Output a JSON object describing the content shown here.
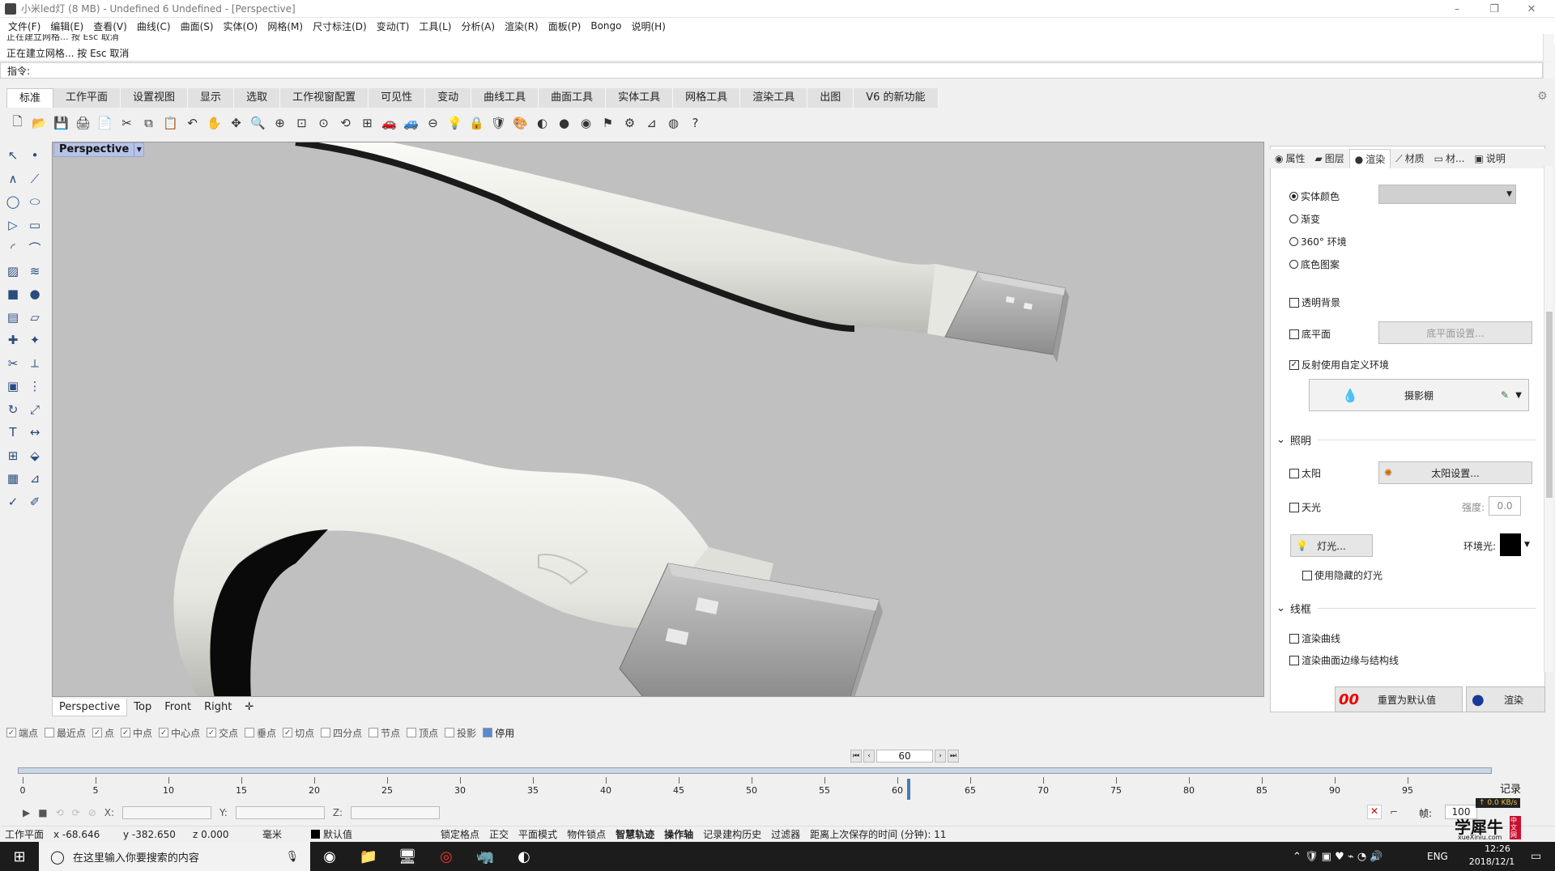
{
  "title": "小米led灯 (8 MB) - Undefined 6 Undefined - [Perspective]",
  "window_controls": {
    "minimize": "–",
    "maximize": "❐",
    "close": "✕"
  },
  "menu": [
    "文件(F)",
    "编辑(E)",
    "查看(V)",
    "曲线(C)",
    "曲面(S)",
    "实体(O)",
    "网格(M)",
    "尺寸标注(D)",
    "变动(T)",
    "工具(L)",
    "分析(A)",
    "渲染(R)",
    "面板(P)",
    "Bongo",
    "说明(H)"
  ],
  "command_history": [
    "正在建立网格... 按 Esc 取消",
    "正在建立网格... 按 Esc 取消"
  ],
  "command_prompt": "指令:",
  "tabs": [
    "标准",
    "工作平面",
    "设置视图",
    "显示",
    "选取",
    "工作视窗配置",
    "可见性",
    "变动",
    "曲线工具",
    "曲面工具",
    "实体工具",
    "网格工具",
    "渲染工具",
    "出图",
    "V6 的新功能"
  ],
  "active_tab": "标准",
  "toolbar_icons": [
    "new-icon",
    "open-icon",
    "save-icon",
    "print-icon",
    "import-icon",
    "cut-icon",
    "copy-icon",
    "paste-icon",
    "undo-icon",
    "pan-icon",
    "move-view-icon",
    "zoom-icon",
    "zoom-window-icon",
    "zoom-extents-icon",
    "zoom-selected-icon",
    "rotate-view-icon",
    "four-view-icon",
    "car-icon",
    "car2-icon",
    "grid-icon",
    "light-icon",
    "lock-icon",
    "layer-icon",
    "color-icon",
    "shade-icon",
    "render-sphere-icon",
    "render-icon",
    "select-filter-icon",
    "settings-gear-icon",
    "options-icon",
    "globe-icon",
    "help-icon"
  ],
  "toolbar_glyphs": [
    "🗋",
    "📂",
    "💾",
    "🖨",
    "📄",
    "✂",
    "⧉",
    "📋",
    "↶",
    "✋",
    "✥",
    "🔍",
    "⊕",
    "⊡",
    "⊙",
    "⟲",
    "⊞",
    "🚗",
    "🚙",
    "⊖",
    "💡",
    "🔒",
    "🛡",
    "🎨",
    "◐",
    "●",
    "◉",
    "⚑",
    "⚙",
    "⊿",
    "◍",
    "?"
  ],
  "viewport": {
    "name": "Perspective",
    "tabs": [
      "Perspective",
      "Top",
      "Front",
      "Right"
    ],
    "add_tab": "✛"
  },
  "panel": {
    "tabs": [
      {
        "label": "属性",
        "icon": "properties-icon",
        "glyph": "◉"
      },
      {
        "label": "图层",
        "icon": "layers-icon",
        "glyph": "▰"
      },
      {
        "label": "渲染",
        "icon": "render-icon",
        "glyph": "●"
      },
      {
        "label": "材质",
        "icon": "material-icon",
        "glyph": "⟋"
      },
      {
        "label": "材...",
        "icon": "folder-icon",
        "glyph": "▭"
      },
      {
        "label": "说明",
        "icon": "help-icon",
        "glyph": "▣"
      }
    ],
    "active_tab": "渲染",
    "background": {
      "options": [
        "实体颜色",
        "渐变",
        "360° 环境",
        "底色图案"
      ],
      "selected": "实体颜色",
      "color": "#d0d0d0"
    },
    "transparent_bg": "透明背景",
    "ground_plane": "底平面",
    "ground_plane_btn": "底平面设置...",
    "custom_env": "反射使用自定义环境",
    "env_name": "摄影棚",
    "lighting_title": "照明",
    "sun": "太阳",
    "sun_btn": "太阳设置...",
    "skylight": "天光",
    "intensity_label": "强度:",
    "intensity_value": "0.0",
    "lights_btn": "灯光...",
    "ambient_label": "环境光:",
    "hidden_lights": "使用隐藏的灯光",
    "wireframe_title": "线框",
    "render_curves": "渲染曲线",
    "render_edges": "渲染曲面边缘与结构线",
    "reset_btn": "重置为默认值",
    "render_btn": "渲染",
    "reset_glyph": "00"
  },
  "snaps": [
    {
      "label": "端点",
      "checked": true
    },
    {
      "label": "最近点",
      "checked": false
    },
    {
      "label": "点",
      "checked": true
    },
    {
      "label": "中点",
      "checked": true
    },
    {
      "label": "中心点",
      "checked": true
    },
    {
      "label": "交点",
      "checked": true
    },
    {
      "label": "垂点",
      "checked": false
    },
    {
      "label": "切点",
      "checked": true
    },
    {
      "label": "四分点",
      "checked": false
    },
    {
      "label": "节点",
      "checked": false
    },
    {
      "label": "顶点",
      "checked": false
    },
    {
      "label": "投影",
      "checked": false
    }
  ],
  "snap_disable": "停用",
  "timeline": {
    "frame": "60",
    "ticks": [
      "0",
      "5",
      "10",
      "15",
      "20",
      "25",
      "30",
      "35",
      "40",
      "45",
      "50",
      "55",
      "60",
      "65",
      "70",
      "75",
      "80",
      "85",
      "90",
      "95"
    ],
    "record": "记录",
    "frame_label": "帧:",
    "frame_value": "100",
    "speed": "↑ 0.0 KB/s",
    "x_label": "X:",
    "y_label": "Y:",
    "z_label": "Z:"
  },
  "status": {
    "cplane": "工作平面",
    "x": "x -68.646",
    "y": "y -382.650",
    "z": "z 0.000",
    "units": "毫米",
    "layer": "默认值",
    "items": [
      "锁定格点",
      "正交",
      "平面模式",
      "物件锁点",
      "智慧轨迹",
      "操作轴",
      "记录建构历史",
      "过滤器"
    ],
    "bold_items": [
      "智慧轨迹",
      "操作轴"
    ],
    "last_save": "距离上次保存的时间 (分钟): 11"
  },
  "taskbar": {
    "search_placeholder": "在这里输入你要搜索的内容",
    "lang": "ENG",
    "time": "12:26",
    "date": "2018/12/1"
  },
  "watermark": {
    "text": "学犀牛",
    "sub": "xueXiniu.com",
    "badge": "中文网"
  },
  "left_tool_icons": [
    "select-arrow-icon",
    "point-icon",
    "polyline-icon",
    "curve-icon",
    "circle-icon",
    "ellipse-icon",
    "polygon-icon",
    "rectangle-icon",
    "arc-icon",
    "fillet-icon",
    "surface-icon",
    "loft-icon",
    "box-icon",
    "sphere-icon",
    "extrude-icon",
    "plane-icon",
    "boolean-icon",
    "explode-icon",
    "trim-icon",
    "split-icon",
    "group-icon",
    "array-icon",
    "rotate-icon",
    "scale-icon",
    "text-icon",
    "dim-icon",
    "mesh-icon",
    "render-tool-icon",
    "grid-snap-icon",
    "analyze-icon",
    "check-icon",
    "misc-icon"
  ],
  "left_tool_glyphs": [
    "↖",
    "•",
    "∧",
    "⟋",
    "◯",
    "⬭",
    "▷",
    "▭",
    "◜",
    "⌒",
    "▨",
    "≋",
    "■",
    "●",
    "▤",
    "▱",
    "✚",
    "✦",
    "✂",
    "⟂",
    "▣",
    "⋮",
    "↻",
    "⤢",
    "T",
    "↔",
    "⊞",
    "⬙",
    "▦",
    "⊿",
    "✓",
    "✐"
  ],
  "colors": {
    "viewport_bg": "#c0c0c0",
    "accent": "#2a4d7f",
    "label_bg": "#b7c3e6"
  }
}
